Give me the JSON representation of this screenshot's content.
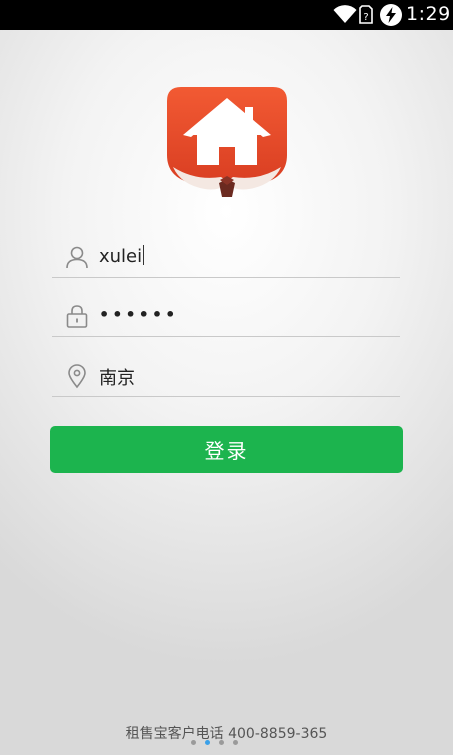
{
  "status_bar": {
    "time": "1:29",
    "icons": [
      "wifi-icon",
      "sim-icon",
      "battery-charging-icon"
    ]
  },
  "app": {
    "logo_icon": "house-logo-icon",
    "brand_colors": {
      "logo_red": "#e84a2c",
      "button_green": "#1cb44e",
      "active_dot": "#3aa0e8"
    }
  },
  "form": {
    "username": {
      "icon": "user-icon",
      "value": "xulei"
    },
    "password": {
      "icon": "lock-icon",
      "value": "••••••"
    },
    "city": {
      "icon": "location-pin-icon",
      "value": "南京"
    },
    "login_label": "登录"
  },
  "footer": {
    "hotline": "租售宝客户电话 400-8859-365"
  },
  "pager": {
    "count": 4,
    "active_index": 1
  }
}
